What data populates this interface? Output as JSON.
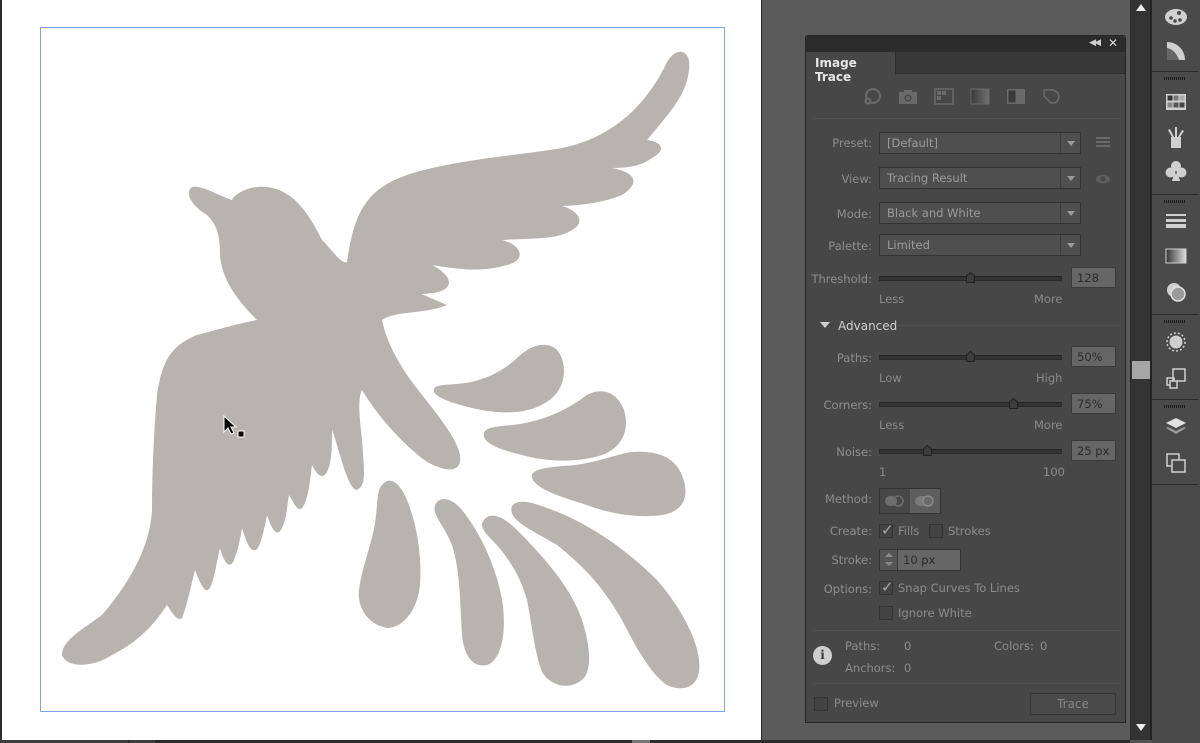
{
  "canvas": {
    "artwork_label": "Bird silhouette artwork",
    "artwork_color": "#b7b3ae",
    "artboard_border_color": "#7fa2f7"
  },
  "panel": {
    "title": "Image Trace",
    "collapse_icon": "double-chevron-left",
    "close_icon": "close-x",
    "preset_icons": [
      {
        "name": "auto-color-icon"
      },
      {
        "name": "high-color-icon"
      },
      {
        "name": "low-color-icon"
      },
      {
        "name": "grayscale-icon"
      },
      {
        "name": "black-and-white-icon"
      },
      {
        "name": "outline-icon"
      }
    ],
    "preset": {
      "label": "Preset:",
      "value": "[Default]"
    },
    "view": {
      "label": "View:",
      "value": "Tracing Result"
    },
    "mode": {
      "label": "Mode:",
      "value": "Black and White"
    },
    "palette": {
      "label": "Palette:",
      "value": "Limited"
    },
    "threshold": {
      "label": "Threshold:",
      "value": "128",
      "min_label": "Less",
      "max_label": "More",
      "fraction": 0.5
    },
    "advanced": {
      "label": "Advanced",
      "expanded": true
    },
    "paths": {
      "label": "Paths:",
      "value": "50%",
      "min_label": "Low",
      "max_label": "High",
      "fraction": 0.5
    },
    "corners": {
      "label": "Corners:",
      "value": "75%",
      "min_label": "Less",
      "max_label": "More",
      "fraction": 0.75
    },
    "noise": {
      "label": "Noise:",
      "value": "25 px",
      "min_label": "1",
      "max_label": "100",
      "fraction": 0.25
    },
    "method": {
      "label": "Method:",
      "options": [
        "Abutting",
        "Overlapping"
      ],
      "selected": "Overlapping"
    },
    "create": {
      "label": "Create:",
      "fills": {
        "label": "Fills",
        "checked": true
      },
      "strokes": {
        "label": "Strokes",
        "checked": false
      }
    },
    "stroke": {
      "label": "Stroke:",
      "value": "10 px"
    },
    "options": {
      "label": "Options:",
      "snap_curves": {
        "label": "Snap Curves To Lines",
        "checked": true
      },
      "ignore_white": {
        "label": "Ignore White",
        "checked": false
      }
    },
    "info": {
      "paths_label": "Paths:",
      "paths_value": "0",
      "colors_label": "Colors:",
      "colors_value": "0",
      "anchors_label": "Anchors:",
      "anchors_value": "0"
    },
    "preview": {
      "label": "Preview",
      "checked": false
    },
    "trace_button": "Trace"
  },
  "dock": {
    "groups": [
      [
        "color-icon",
        "color-guide-icon"
      ],
      [
        "swatches-icon",
        "brushes-icon",
        "symbols-icon"
      ],
      [
        "stroke-icon",
        "gradient-icon",
        "transparency-icon"
      ],
      [
        "appearance-icon",
        "graphic-styles-icon"
      ],
      [
        "layers-icon",
        "artboards-icon"
      ]
    ]
  },
  "scrollbar": {
    "position_fraction": 0.5
  }
}
